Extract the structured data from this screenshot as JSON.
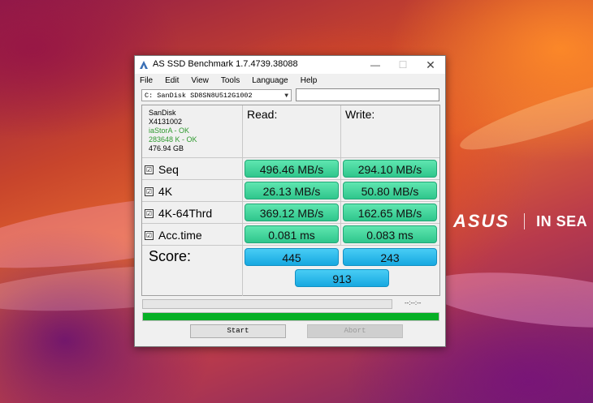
{
  "desktop": {
    "brand_logo": "ASUS",
    "brand_tagline": "IN SEA"
  },
  "window": {
    "title": "AS SSD Benchmark 1.7.4739.38088",
    "controls": {
      "minimize": "—",
      "maximize": "☐",
      "close": "✕"
    }
  },
  "menu": [
    "File",
    "Edit",
    "View",
    "Tools",
    "Language",
    "Help"
  ],
  "drive_select": {
    "value": "C: SanDisk SD8SN8U512G1002",
    "extra_value": ""
  },
  "drive_info": {
    "vendor": "SanDisk",
    "firmware": "X4131002",
    "driver": "iaStorA - OK",
    "alignment": "283648 K - OK",
    "size": "476.94 GB"
  },
  "headers": {
    "read": "Read:",
    "write": "Write:"
  },
  "rows": [
    {
      "check": "☑",
      "label": "Seq",
      "read": "496.46 MB/s",
      "write": "294.10 MB/s"
    },
    {
      "check": "☑",
      "label": "4K",
      "read": "26.13 MB/s",
      "write": "50.80 MB/s"
    },
    {
      "check": "☑",
      "label": "4K-64Thrd",
      "read": "369.12 MB/s",
      "write": "162.65 MB/s"
    },
    {
      "check": "☑",
      "label": "Acc.time",
      "read": "0.081 ms",
      "write": "0.083 ms"
    }
  ],
  "score": {
    "label": "Score:",
    "read": "445",
    "write": "243",
    "total": "913"
  },
  "progress": {
    "time_text": "--:--:--",
    "fraction": 1.0
  },
  "buttons": {
    "start": "Start",
    "abort": "Abort"
  },
  "colors": {
    "result_green": "#2fc68c",
    "score_blue": "#17a8e0",
    "progress_green": "#06b025"
  }
}
